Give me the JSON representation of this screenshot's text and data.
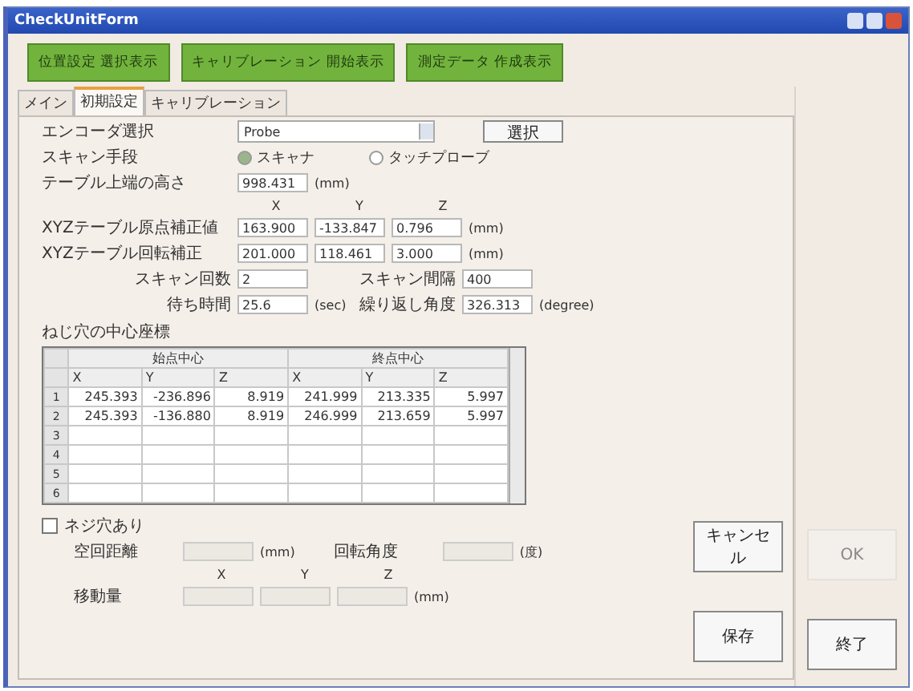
{
  "window": {
    "title": "CheckUnitForm"
  },
  "top_buttons": [
    "位置設定 選択表示",
    "キャリブレーション 開始表示",
    "測定データ 作成表示"
  ],
  "tabs": [
    {
      "label": "メイン",
      "selected": false
    },
    {
      "label": "初期設定",
      "selected": true
    },
    {
      "label": "キャリブレーション",
      "selected": false
    }
  ],
  "encoder": {
    "label": "エンコーダ選択",
    "value": "Probe",
    "button": "選択"
  },
  "scan_method": {
    "label": "スキャン手段",
    "options": [
      {
        "label": "スキャナ",
        "selected": true
      },
      {
        "label": "タッチプローブ",
        "selected": false
      }
    ]
  },
  "table_height": {
    "label": "テーブル上端の高さ",
    "value": "998.431",
    "unit": "(mm)"
  },
  "xyz_headers": [
    "X",
    "Y",
    "Z"
  ],
  "vector_rows": [
    {
      "label": "XYZテーブル原点補正値",
      "values": [
        "163.900",
        "-133.847",
        "0.796"
      ],
      "unit": "(mm)"
    },
    {
      "label": "XYZテーブル回転補正",
      "values": [
        "201.000",
        "118.461",
        "3.000"
      ],
      "unit": "(mm)"
    }
  ],
  "field_pairs": [
    {
      "items": [
        {
          "label": "スキャン回数",
          "value": "2"
        },
        {
          "label": "スキャン間隔",
          "value": "400"
        }
      ]
    },
    {
      "items": [
        {
          "label": "待ち時間",
          "value": "25.6",
          "unit": "(sec)"
        },
        {
          "label": "繰り返し角度",
          "value": "326.313",
          "unit": "(degree)"
        }
      ]
    }
  ],
  "hole_table": {
    "title": "ねじ穴の中心座標",
    "groups": [
      "始点中心",
      "終点中心"
    ],
    "columns": [
      "X",
      "Y",
      "Z",
      "X",
      "Y",
      "Z"
    ],
    "rows": [
      {
        "number": "1",
        "cells": [
          "245.393",
          "-236.896",
          "8.919",
          "241.999",
          "213.335",
          "5.997"
        ]
      },
      {
        "number": "2",
        "cells": [
          "245.393",
          "-136.880",
          "8.919",
          "246.999",
          "213.659",
          "5.997"
        ]
      },
      {
        "number": "3"
      },
      {
        "number": "4"
      },
      {
        "number": "5"
      },
      {
        "number": "6"
      }
    ]
  },
  "screw_hole": {
    "label": "ネジ穴あり",
    "checked": false,
    "fields": [
      {
        "label": "空回距離",
        "unit": "(mm)",
        "disabled": true
      },
      {
        "label": "回転角度",
        "unit": "(度)",
        "disabled": true
      }
    ],
    "move": {
      "headers": [
        "X",
        "Y",
        "Z"
      ],
      "label": "移動量",
      "unit": "(mm)",
      "disabled": true
    }
  },
  "side_buttons": [
    {
      "label": "キャンセル",
      "disabled": false
    },
    {
      "label": "保存",
      "disabled": false
    }
  ],
  "right_buttons": [
    {
      "label": "OK",
      "disabled": true
    },
    {
      "label": "終了",
      "disabled": false
    }
  ]
}
